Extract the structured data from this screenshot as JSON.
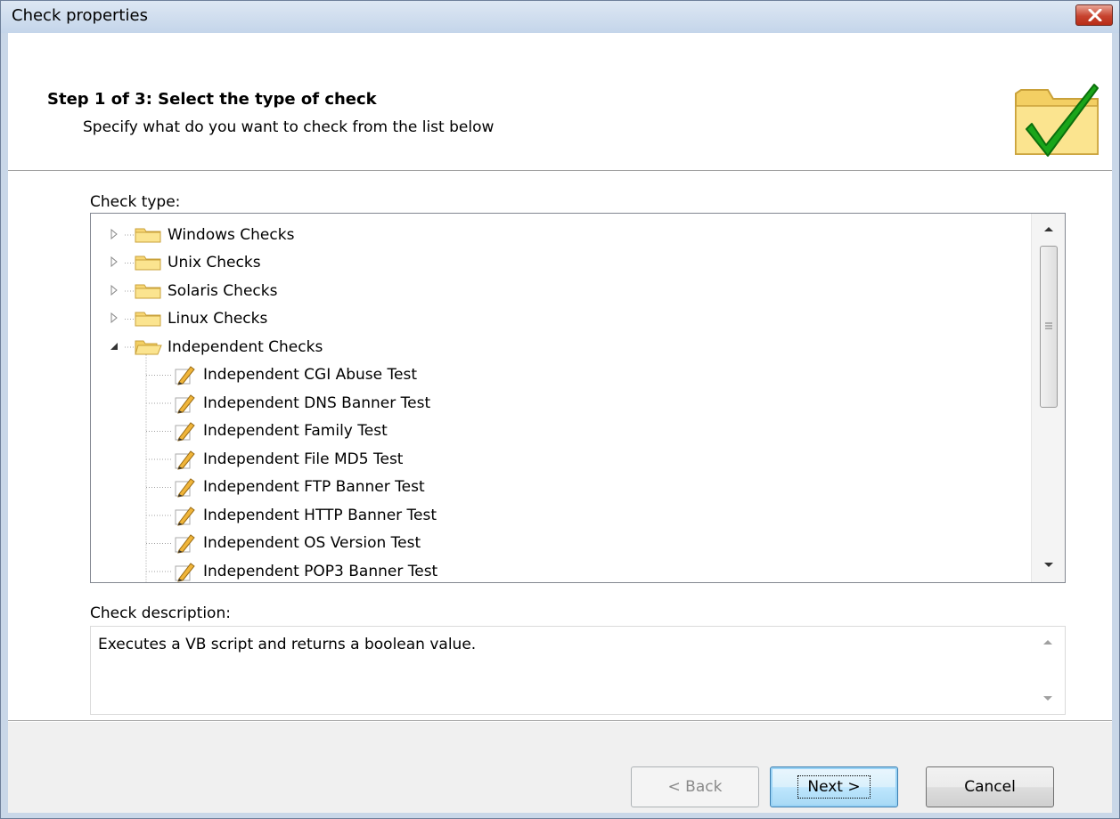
{
  "window": {
    "title": "Check properties"
  },
  "header": {
    "step_title": "Step 1 of 3: Select the type of check",
    "step_subtitle": "Specify what do you want to check from the list below",
    "icon": "folder-checkmark-icon"
  },
  "check_type": {
    "label": "Check type:",
    "tree": [
      {
        "label": "Windows Checks",
        "type": "folder",
        "expanded": false
      },
      {
        "label": "Unix Checks",
        "type": "folder",
        "expanded": false
      },
      {
        "label": "Solaris Checks",
        "type": "folder",
        "expanded": false
      },
      {
        "label": "Linux Checks",
        "type": "folder",
        "expanded": false
      },
      {
        "label": "Independent Checks",
        "type": "folder",
        "expanded": true
      }
    ],
    "children": [
      "Independent CGI Abuse Test",
      "Independent DNS Banner Test",
      "Independent Family Test",
      "Independent File MD5 Test",
      "Independent FTP Banner Test",
      "Independent HTTP Banner Test",
      "Independent OS Version Test",
      "Independent POP3 Banner Test"
    ]
  },
  "check_description": {
    "label": "Check description:",
    "text": "Executes a VB script and returns a boolean value."
  },
  "buttons": {
    "back": "< Back",
    "next": "Next >",
    "cancel": "Cancel"
  },
  "colors": {
    "title_bar": "#c4d5ea",
    "close_button": "#c7432f",
    "folder": "#f8d775",
    "check": "#19a319"
  }
}
